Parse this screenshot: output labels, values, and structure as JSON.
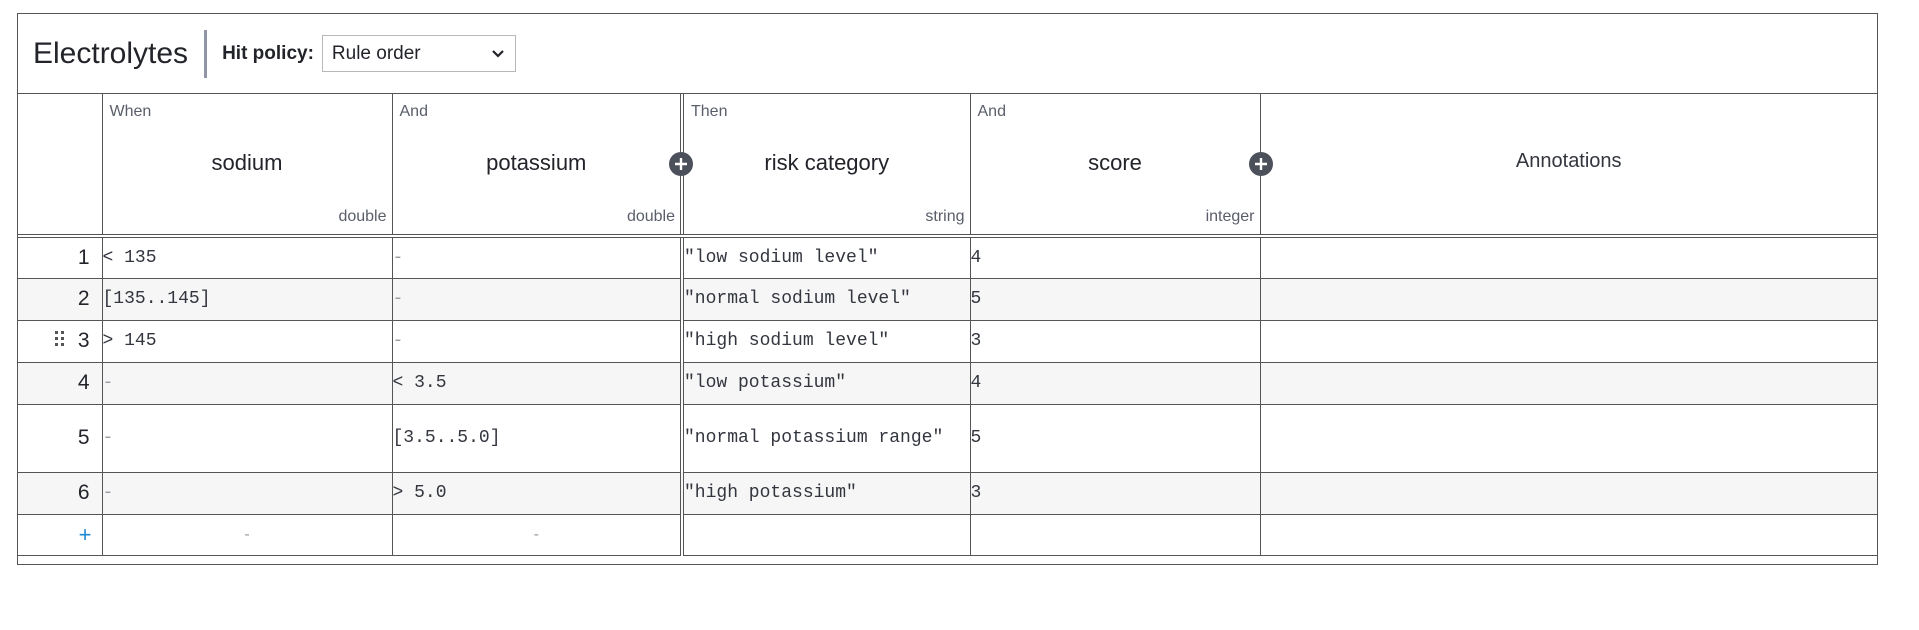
{
  "decision": {
    "title": "Electrolytes",
    "hit_policy_label": "Hit policy:",
    "hit_policy_value": "Rule order"
  },
  "columns": {
    "input1": {
      "clause": "When",
      "label": "sodium",
      "type": "double"
    },
    "input2": {
      "clause": "And",
      "label": "potassium",
      "type": "double"
    },
    "output1": {
      "clause": "Then",
      "label": "risk category",
      "type": "string"
    },
    "output2": {
      "clause": "And",
      "label": "score",
      "type": "integer"
    },
    "annotations": {
      "label": "Annotations"
    }
  },
  "rules": [
    {
      "num": "1",
      "sodium": "< 135",
      "potassium": "-",
      "risk": "\"low sodium level\"",
      "score": "4",
      "annotation": ""
    },
    {
      "num": "2",
      "sodium": "[135..145]",
      "potassium": "-",
      "risk": "\"normal sodium level\"",
      "score": "5",
      "annotation": ""
    },
    {
      "num": "3",
      "sodium": "> 145",
      "potassium": "-",
      "risk": "\"high sodium level\"",
      "score": "3",
      "annotation": ""
    },
    {
      "num": "4",
      "sodium": "-",
      "potassium": "< 3.5",
      "risk": "\"low potassium\"",
      "score": "4",
      "annotation": ""
    },
    {
      "num": "5",
      "sodium": "-",
      "potassium": "[3.5..5.0]",
      "risk": "\"normal potassium range\"",
      "score": "5",
      "annotation": ""
    },
    {
      "num": "6",
      "sodium": "-",
      "potassium": "> 5.0",
      "risk": "\"high potassium\"",
      "score": "3",
      "annotation": ""
    }
  ],
  "footer": {
    "add_symbol": "+",
    "input1_placeholder": "-",
    "input2_placeholder": "-"
  },
  "icons": {
    "add_column": "plus-circle-icon",
    "dropdown": "chevron-down-icon",
    "drag": "drag-handle-icon"
  }
}
